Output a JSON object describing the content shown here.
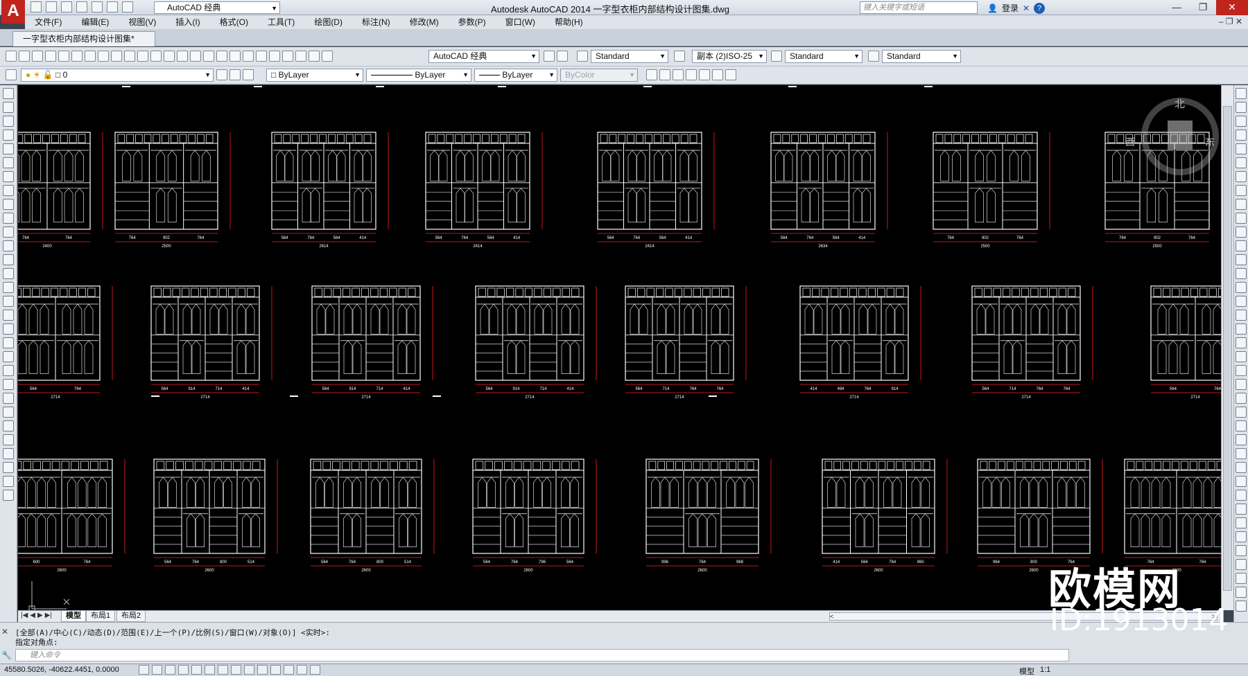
{
  "title_bar": {
    "app_logo": "A",
    "workspace": "AutoCAD 经典",
    "title": "Autodesk AutoCAD 2014    一字型衣柜内部结构设计图集.dwg",
    "search_placeholder": "键入关键字或短语",
    "login": "登录"
  },
  "menu": [
    "文件(F)",
    "编辑(E)",
    "视图(V)",
    "插入(I)",
    "格式(O)",
    "工具(T)",
    "绘图(D)",
    "标注(N)",
    "修改(M)",
    "参数(P)",
    "窗口(W)",
    "帮助(H)"
  ],
  "doc_tab": "一字型衣柜内部结构设计图集*",
  "toolbar1": {
    "workspace_combo": "AutoCAD 经典",
    "text_style": "Standard",
    "dim_style": "副本 (2)ISO-25",
    "table_style": "Standard",
    "mleader_style": "Standard"
  },
  "toolbar2": {
    "layer": "0",
    "color": "ByLayer",
    "linetype": "ByLayer",
    "lineweight": "ByLayer",
    "plotstyle": "ByColor"
  },
  "viewcube": {
    "north": "北",
    "west": "西",
    "east": "东"
  },
  "layout_tabs": [
    "模型",
    "布局1",
    "布局2"
  ],
  "command": {
    "line1": "[全部(A)/中心(C)/动态(D)/范围(E)/上一个(P)/比例(S)/窗口(W)/对象(O)] <实时>:",
    "line2": "指定对角点:",
    "input_placeholder": "键入命令"
  },
  "status": {
    "coords": "45580.5026, -40622.4451, 0.0000",
    "model": "模型",
    "scale": "1:1"
  },
  "watermark": {
    "brand": "欧模网",
    "id": "ID:1913014"
  },
  "drawings": {
    "row1": [
      {
        "total": "2400",
        "dims": [
          "764",
          "764"
        ]
      },
      {
        "total": "2500",
        "dims": [
          "764",
          "902",
          "764"
        ]
      },
      {
        "total": "2614",
        "dims": [
          "564",
          "764",
          "564",
          "414"
        ]
      },
      {
        "total": "2414",
        "dims": [
          "564",
          "764",
          "564",
          "414"
        ]
      },
      {
        "total": "2414",
        "dims": [
          "564",
          "764",
          "564",
          "414"
        ]
      },
      {
        "total": "2634",
        "dims": [
          "564",
          "764",
          "564",
          "414"
        ]
      },
      {
        "total": "2500",
        "dims": [
          "764",
          "902",
          "764"
        ]
      },
      {
        "total": "2500",
        "dims": [
          "764",
          "902",
          "764"
        ]
      }
    ],
    "row2": [
      {
        "total": "2714",
        "dims": [
          "564",
          "764"
        ]
      },
      {
        "total": "2714",
        "dims": [
          "564",
          "914",
          "714",
          "414"
        ]
      },
      {
        "total": "2714",
        "dims": [
          "564",
          "914",
          "714",
          "414"
        ]
      },
      {
        "total": "2714",
        "dims": [
          "564",
          "914",
          "714",
          "414"
        ]
      },
      {
        "total": "2714",
        "dims": [
          "564",
          "714",
          "764",
          "764"
        ]
      },
      {
        "total": "2714",
        "dims": [
          "414",
          "494",
          "764",
          "914"
        ]
      },
      {
        "total": "2714",
        "dims": [
          "564",
          "714",
          "764",
          "764"
        ]
      },
      {
        "total": "2714",
        "dims": [
          "564",
          "764"
        ]
      }
    ],
    "row3": [
      {
        "total": "2600",
        "dims": [
          "600",
          "764"
        ]
      },
      {
        "total": "2600",
        "dims": [
          "564",
          "764",
          "800",
          "514"
        ]
      },
      {
        "total": "2600",
        "dims": [
          "564",
          "764",
          "800",
          "514"
        ]
      },
      {
        "total": "2600",
        "dims": [
          "564",
          "764",
          "796",
          "564"
        ]
      },
      {
        "total": "2600",
        "dims": [
          "996",
          "764",
          "968"
        ]
      },
      {
        "total": "2600",
        "dims": [
          "414",
          "564",
          "764",
          "960"
        ]
      },
      {
        "total": "2600",
        "dims": [
          "964",
          "800",
          "764"
        ]
      },
      {
        "total": "2600",
        "dims": [
          "764",
          "764"
        ]
      }
    ]
  }
}
